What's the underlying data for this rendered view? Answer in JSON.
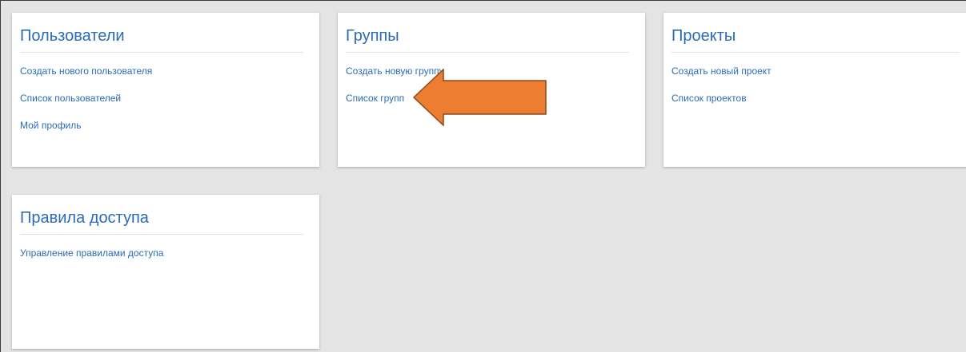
{
  "colors": {
    "link": "#2b6cb8",
    "background": "#e4e4e4",
    "card": "#ffffff",
    "arrow_fill": "#ed7d31",
    "arrow_stroke": "#8c4a1a"
  },
  "cards": [
    {
      "title": "Пользователи",
      "links": [
        "Создать нового пользователя",
        "Список пользователей",
        "Мой профиль"
      ]
    },
    {
      "title": "Группы",
      "links": [
        "Создать новую группу",
        "Список групп"
      ]
    },
    {
      "title": "Проекты",
      "links": [
        "Создать новый проект",
        "Список проектов"
      ]
    },
    {
      "title": "Правила доступа",
      "links": [
        "Управление правилами доступа"
      ]
    }
  ],
  "annotation": {
    "icon": "arrow-left-icon",
    "points_to": "Список групп"
  }
}
